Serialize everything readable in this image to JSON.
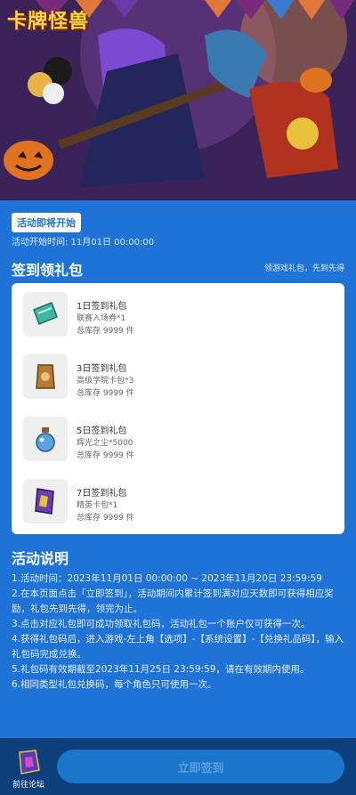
{
  "banner": {
    "logo_text": "卡牌怪兽"
  },
  "status": {
    "badge": "活动即将开始",
    "start_time": "活动开始时间: 11月01日 00:00:00"
  },
  "signin": {
    "title": "签到领礼包",
    "note": "领游戏礼包，先到先得",
    "gifts": [
      {
        "name": "1日签到礼包",
        "item": "联赛入场券*1",
        "stock": "总库存 9999 件",
        "icon": "ticket-icon",
        "color": "#3fb6a0"
      },
      {
        "name": "3日签到礼包",
        "item": "高级学院卡包*3",
        "stock": "总库存 9999 件",
        "icon": "card-pack-icon",
        "color": "#b57a33"
      },
      {
        "name": "5日签到礼包",
        "item": "辉光之尘*5000",
        "stock": "总库存 9999 件",
        "icon": "dust-bottle-icon",
        "color": "#59a4de"
      },
      {
        "name": "7日签到礼包",
        "item": "精英卡包*1",
        "stock": "总库存 9999 件",
        "icon": "elite-card-pack-icon",
        "color": "#6a3db8"
      }
    ]
  },
  "rules": {
    "title": "活动说明",
    "lines": [
      "1.活动时间：2023年11月01日 00:00:00 ~ 2023年11月20日 23:59:59",
      "2.在本页面点击「立即签到」，活动期间内累计签到满对应天数即可获得相应奖励，礼包先到先得，领完为止。",
      "3.点击对应礼包即可成功领取礼包码，活动礼包一个账户仅可获得一次。",
      "4.获得礼包码后，进入游戏-左上角【选项】-【系统设置】-【兑换礼品码】，输入礼包码完成兑换。",
      "5.礼包码有效期截至2023年11月25日 23:59:59，请在有效期内使用。",
      "6.相同类型礼包兑换码，每个角色只可使用一次。"
    ]
  },
  "footer": {
    "forum_label": "前往论坛",
    "checkin_label": "立即签到"
  },
  "colors": {
    "page_bg": "#1f72d6",
    "footer_bg": "#0d3f7a",
    "button_bg": "#1b75c9"
  }
}
